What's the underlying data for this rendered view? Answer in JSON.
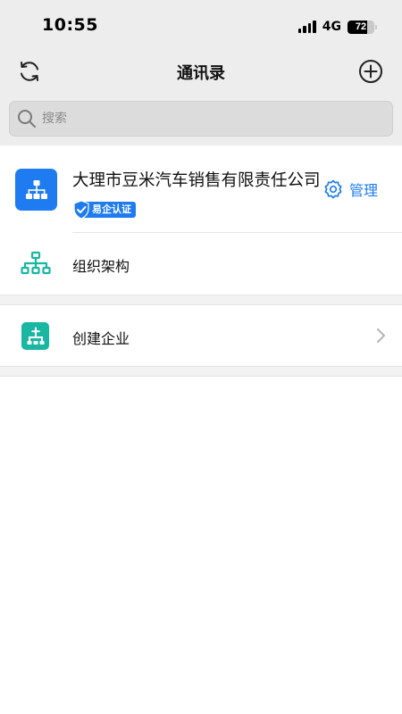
{
  "status_bar": {
    "time": "10:55",
    "network": "4G",
    "battery_level": 72,
    "battery_text": "72"
  },
  "nav": {
    "title": "通讯录",
    "left_icon": "refresh-icon",
    "right_icon": "add-circle-icon"
  },
  "search": {
    "placeholder": "搜索",
    "icon": "search-icon"
  },
  "company": {
    "name": "大理市豆米汽车销售有限责任公司",
    "badge_label": "易企认证",
    "manage_label": "管理",
    "logo_icon": "org-chart-icon",
    "org_row_label": "组织架构"
  },
  "actions": {
    "create_label": "创建企业"
  },
  "colors": {
    "accent": "#1e7cf0",
    "teal": "#19b6a2",
    "header_bg": "#ededed"
  }
}
